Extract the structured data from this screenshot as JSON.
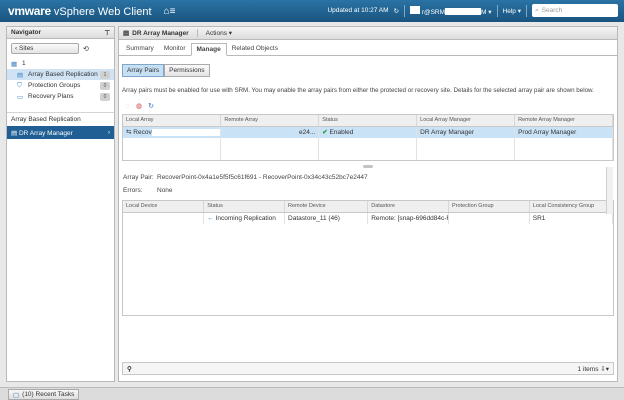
{
  "header": {
    "brand_vm": "vmware",
    "brand_product": "vSphere Web Client",
    "home_icon": "home-icon",
    "updated": "Updated at 10:27 AM",
    "user": "r@SRM",
    "user_suffix": "M",
    "help": "Help",
    "search_placeholder": "Search",
    "colors": {
      "bar": "#1d5f8a"
    }
  },
  "navigator": {
    "title": "Navigator",
    "back_label": "Sites",
    "root": "1",
    "items": [
      {
        "label": "Array Based Replication",
        "count": "1"
      },
      {
        "label": "Protection Groups",
        "count": "0"
      },
      {
        "label": "Recovery Plans",
        "count": "0"
      }
    ],
    "section": "Array Based Replication",
    "selected": "DR Array Manager"
  },
  "main": {
    "object_title": "DR Array Manager",
    "actions": "Actions",
    "tabs": [
      "Summary",
      "Monitor",
      "Manage",
      "Related Objects"
    ],
    "subtabs": [
      "Array Pairs",
      "Permissions"
    ],
    "info": "Array pairs must be enabled for use with SRM. You may enable the array pairs from either the protected or recovery site. Details for the selected array pair are shown below.",
    "pairs_table": {
      "columns": [
        "Local Array",
        "Remote Array",
        "Status",
        "Local Array Manager",
        "Remote Array Manager"
      ],
      "row": {
        "local": "Recov",
        "remote": "e24...",
        "status": "Enabled",
        "local_mgr": "DR Array Manager",
        "remote_mgr": "Prod Array Manager"
      }
    },
    "detail": {
      "pair_label": "Array Pair:",
      "pair_value": "RecoverPoint-0x4a1e5f5f5c61f691 - RecoverPoint-0x34c43c52bc7e2447",
      "errors_label": "Errors:",
      "errors_value": "None"
    },
    "devices_table": {
      "columns": [
        "Local Device",
        "Status",
        "Remote Device",
        "Datastore",
        "Protection Group",
        "Local Consistency Group"
      ],
      "row": {
        "local": "",
        "status": "Incoming Replication",
        "remote": "Datastore_11 (46)",
        "datastore": "Remote: [snap-696dd84c-R...",
        "group": "",
        "cg": "SR1"
      }
    },
    "footer_count": "1 items"
  },
  "bottom": {
    "recent_tasks": "(10)  Recent Tasks"
  }
}
